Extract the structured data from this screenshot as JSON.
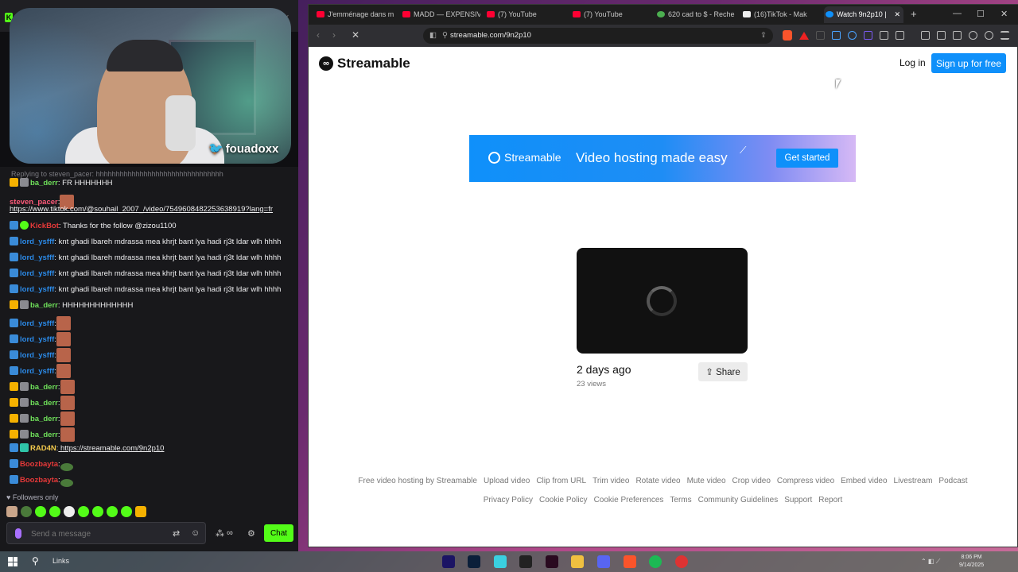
{
  "stream": {
    "handle": "fouadoxx",
    "chat": {
      "reply": "Replying to steven_pacer: hhhhhhhhhhhhhhhhhhhhhhhhhhhhhhhh",
      "messages": [
        {
          "user": "ba_derr",
          "text": ": FR HHHHHHH",
          "color": "#6fe05a"
        },
        {
          "user": "steven_pacer",
          "text": ":",
          "color": "#ff5a7a"
        },
        {
          "user": "",
          "text": "https://www.tiktok.com/@souhail_2007_/video/7549608482253638919?lang=fr",
          "color": "#efeff1"
        },
        {
          "user": "KickBot",
          "text": ": Thanks for the follow @zizou1100",
          "color": "#e63939"
        },
        {
          "user": "lord_ysfff",
          "text": ": knt ghadi lbareh mdrassa mea khrjt bant lya hadi rj3t ldar wlh hhhh",
          "color": "#2b8ae8"
        },
        {
          "user": "lord_ysfff",
          "text": ": knt ghadi lbareh mdrassa mea khrjt bant lya hadi rj3t ldar wlh hhhh",
          "color": "#2b8ae8"
        },
        {
          "user": "lord_ysfff",
          "text": ": knt ghadi lbareh mdrassa mea khrjt bant lya hadi rj3t ldar wlh hhhh",
          "color": "#2b8ae8"
        },
        {
          "user": "lord_ysfff",
          "text": ": knt ghadi lbareh mdrassa mea khrjt bant lya hadi rj3t ldar wlh hhhh",
          "color": "#2b8ae8"
        },
        {
          "user": "ba_derr",
          "text": ": HHHHHHHHHHHHH",
          "color": "#6fe05a"
        },
        {
          "user": "lord_ysfff",
          "text": ":",
          "color": "#2b8ae8"
        },
        {
          "user": "lord_ysfff",
          "text": ":",
          "color": "#2b8ae8"
        },
        {
          "user": "lord_ysfff",
          "text": ":",
          "color": "#2b8ae8"
        },
        {
          "user": "lord_ysfff",
          "text": ":",
          "color": "#2b8ae8"
        },
        {
          "user": "ba_derr",
          "text": ":",
          "color": "#6fe05a"
        },
        {
          "user": "ba_derr",
          "text": ":",
          "color": "#6fe05a"
        },
        {
          "user": "ba_derr",
          "text": ":",
          "color": "#6fe05a"
        },
        {
          "user": "ba_derr",
          "text": ":",
          "color": "#6fe05a"
        },
        {
          "user": "RAD4N",
          "text": ":",
          "color": "#f2c94c",
          "link": "https://streamable.com/9n2p10"
        },
        {
          "user": "Boozbayta",
          "text": ":",
          "color": "#e63939"
        },
        {
          "user": "Boozbayta",
          "text": ":",
          "color": "#e63939"
        }
      ],
      "followers_only": "Followers only",
      "input_placeholder": "Send a message",
      "chat_button": "Chat"
    }
  },
  "browser": {
    "tabs": [
      {
        "label": "J'emménage dans m"
      },
      {
        "label": "MADD — EXPENSIVE"
      },
      {
        "label": "(7) YouTube"
      },
      {
        "label": "(7) YouTube"
      },
      {
        "label": "620 cad to $ - Reche"
      },
      {
        "label": "(16)TikTok - Mak"
      },
      {
        "label": "Watch 9n2p10 |"
      }
    ],
    "url": "streamable.com/9n2p10"
  },
  "page": {
    "logo": "Streamable",
    "login": "Log in",
    "signup": "Sign up for free",
    "banner": {
      "logo": "Streamable",
      "tagline": "Video hosting made easy",
      "cta": "Get started"
    },
    "video": {
      "age": "2 days ago",
      "views": "23 views",
      "share": "Share"
    },
    "footer_row1": [
      "Free video hosting by Streamable",
      "Upload video",
      "Clip from URL",
      "Trim video",
      "Rotate video",
      "Mute video",
      "Crop video",
      "Compress video",
      "Embed video",
      "Livestream",
      "Podcast"
    ],
    "footer_row2": [
      "Privacy Policy",
      "Cookie Policy",
      "Cookie Preferences",
      "Terms",
      "Community Guidelines",
      "Support",
      "Report"
    ]
  },
  "taskbar": {
    "links": "Links",
    "time": "8:06 PM",
    "date": "9/14/2025"
  }
}
